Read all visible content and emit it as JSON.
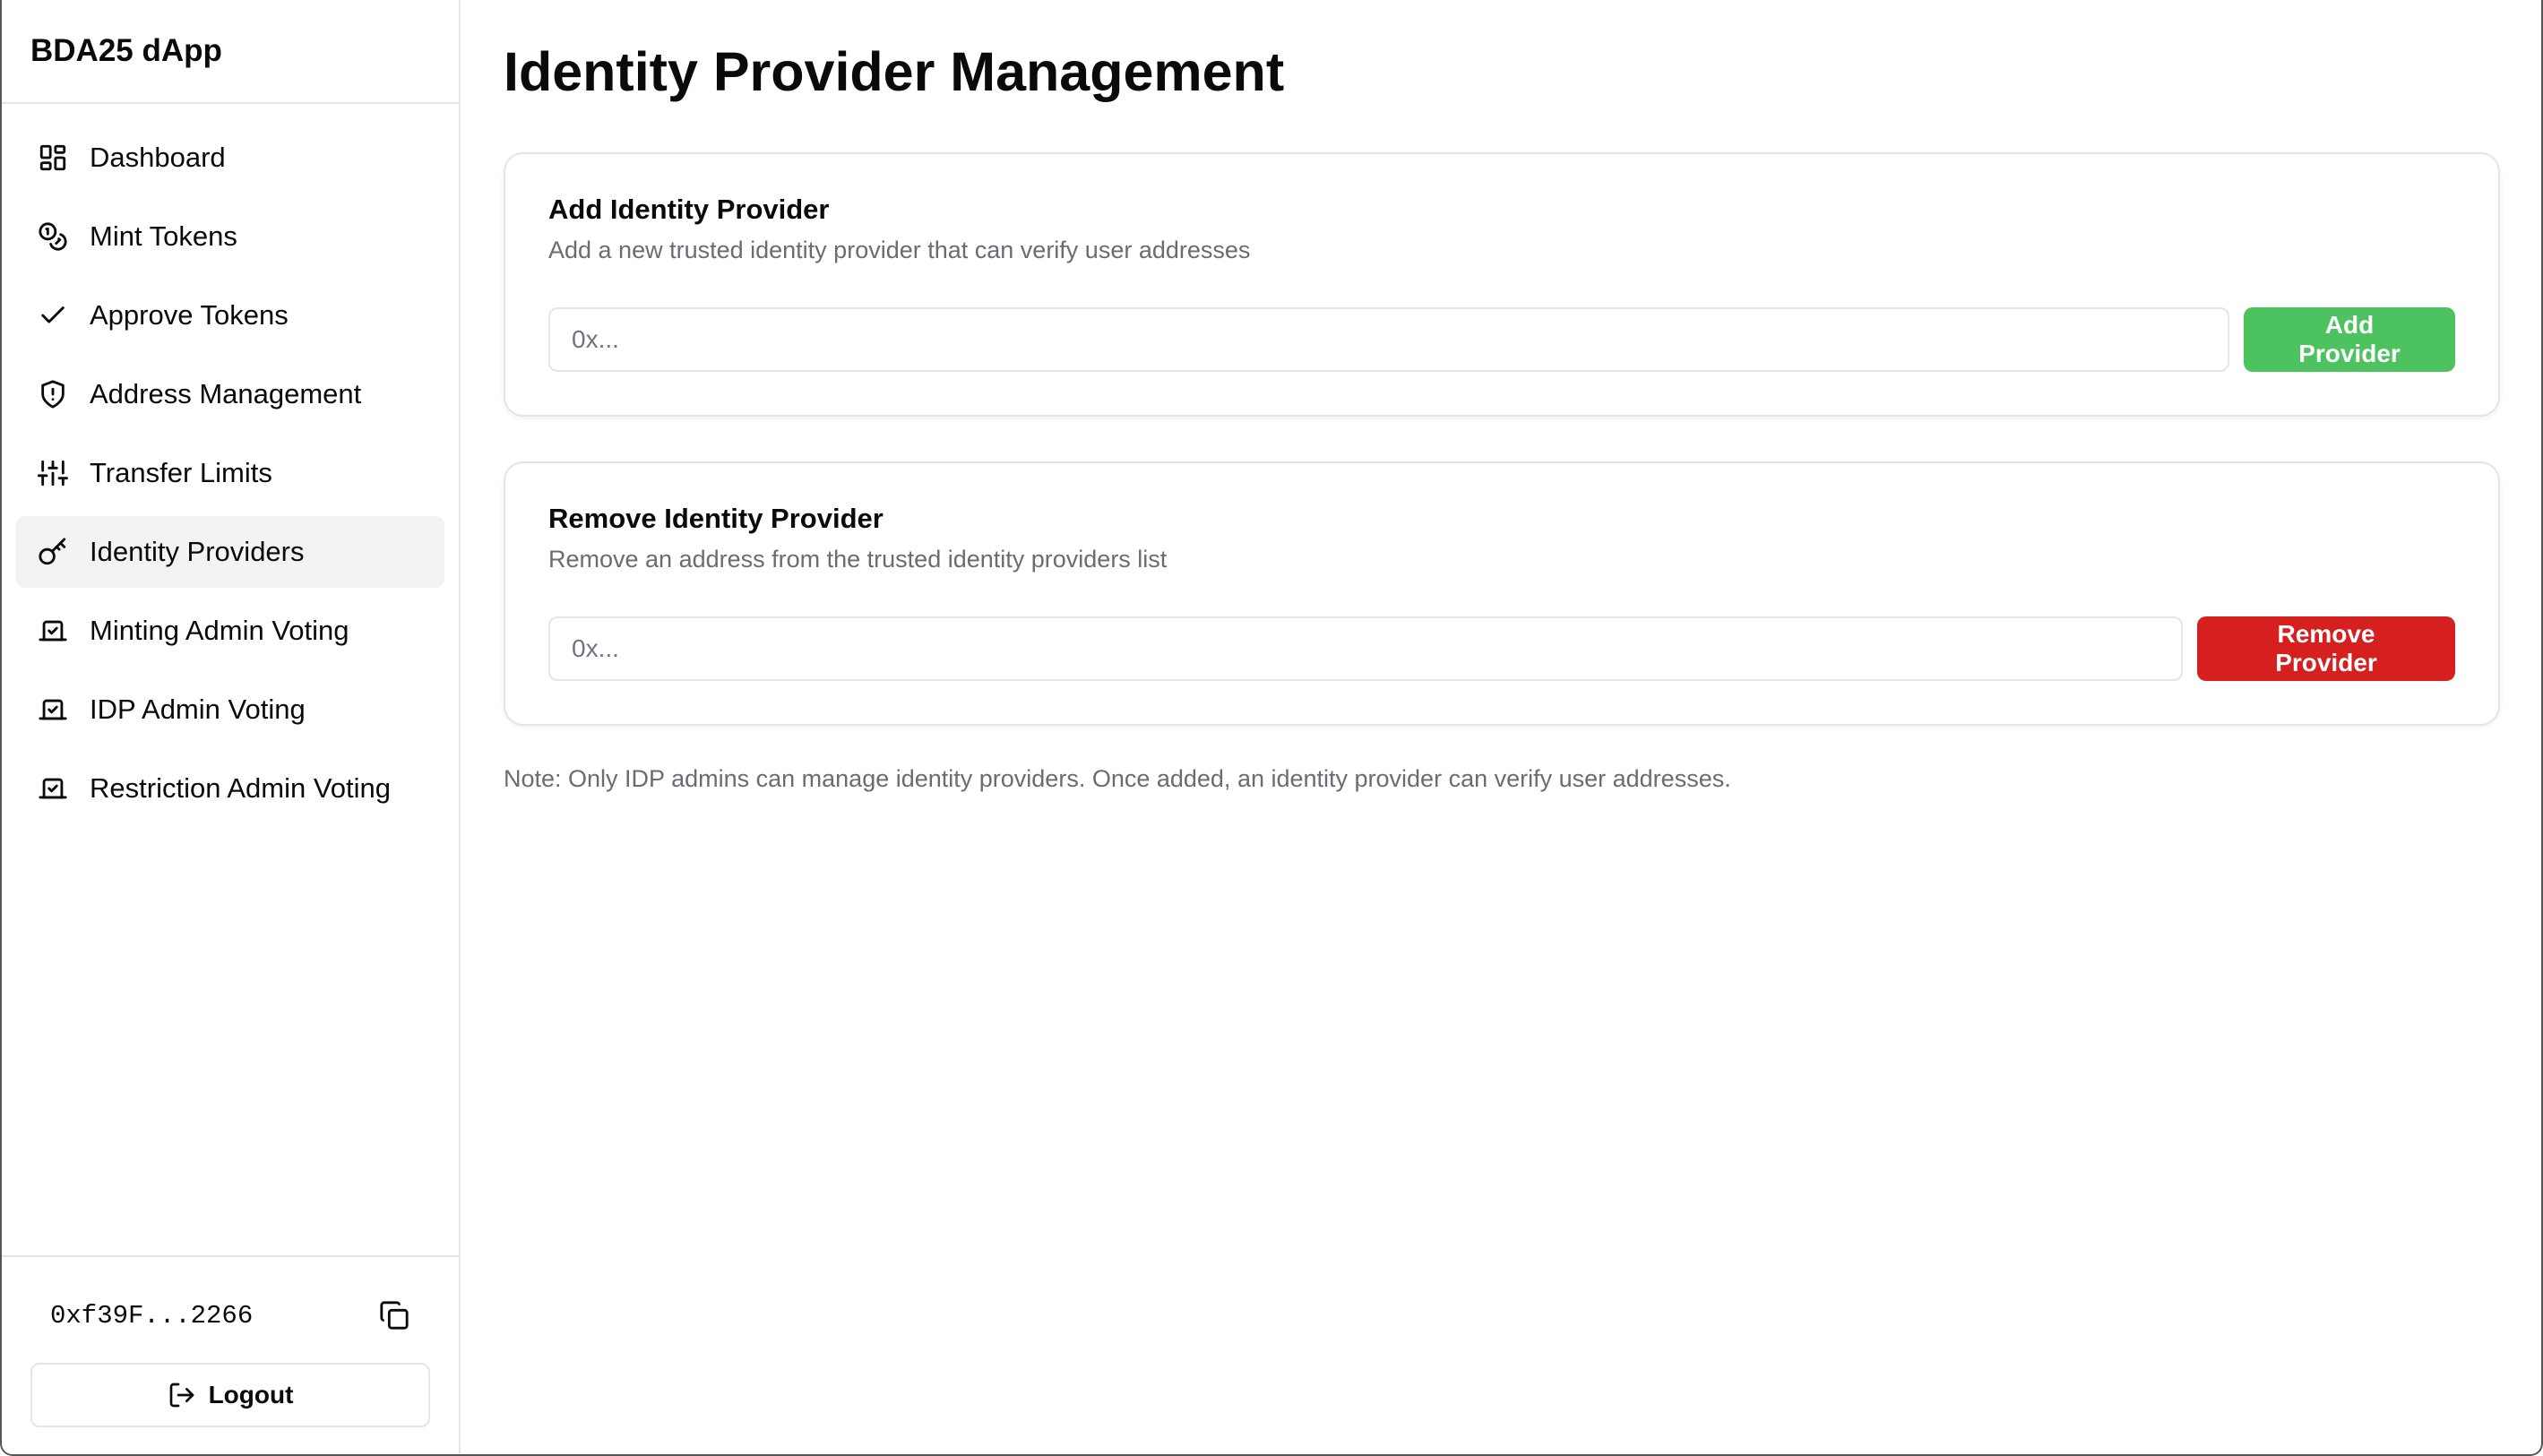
{
  "app": {
    "title": "BDA25 dApp"
  },
  "sidebar": {
    "items": [
      {
        "label": "Dashboard",
        "icon": "dashboard-icon",
        "active": false
      },
      {
        "label": "Mint Tokens",
        "icon": "coins-icon",
        "active": false
      },
      {
        "label": "Approve Tokens",
        "icon": "check-icon",
        "active": false
      },
      {
        "label": "Address Management",
        "icon": "shield-alert-icon",
        "active": false
      },
      {
        "label": "Transfer Limits",
        "icon": "sliders-icon",
        "active": false
      },
      {
        "label": "Identity Providers",
        "icon": "key-icon",
        "active": true
      },
      {
        "label": "Minting Admin Voting",
        "icon": "vote-icon",
        "active": false
      },
      {
        "label": "IDP Admin Voting",
        "icon": "vote-icon",
        "active": false
      },
      {
        "label": "Restriction Admin Voting",
        "icon": "vote-icon",
        "active": false
      }
    ],
    "footer": {
      "wallet_address": "0xf39F...2266",
      "copy_icon": "copy-icon",
      "logout_label": "Logout",
      "logout_icon": "logout-icon"
    }
  },
  "main": {
    "title": "Identity Provider Management",
    "add_card": {
      "title": "Add Identity Provider",
      "description": "Add a new trusted identity provider that can verify user addresses",
      "input_placeholder": "0x...",
      "input_value": "",
      "button_label": "Add Provider"
    },
    "remove_card": {
      "title": "Remove Identity Provider",
      "description": "Remove an address from the trusted identity providers list",
      "input_placeholder": "0x...",
      "input_value": "",
      "button_label": "Remove Provider"
    },
    "note": "Note: Only IDP admins can manage identity providers. Once added, an identity provider can verify user addresses."
  },
  "colors": {
    "add_button": "#4cc35e",
    "remove_button": "#d61f1f",
    "active_nav_bg": "#f3f3f4",
    "muted_text": "#6b6b73"
  }
}
